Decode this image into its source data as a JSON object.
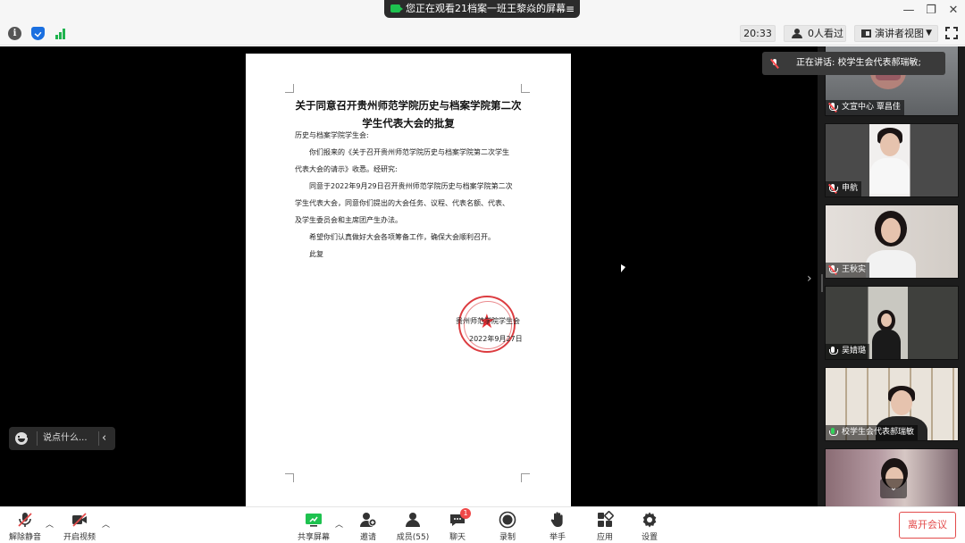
{
  "titlebar": {
    "share_notice": "您正在观看21档案一班王黎焱的屏幕",
    "menu_icon": "≡"
  },
  "statusbar": {
    "time": "20:33",
    "viewers": "0人看过",
    "view_mode": "演讲者视图"
  },
  "document": {
    "title": "关于同意召开贵州师范学院历史与档案学院第二次学生代表大会的批复",
    "addressee": "历史与档案学院学生会:",
    "p1a": "你们报来的《关于召开贵州师范学院历史与档案学院第二次学生",
    "p1b": "代表大会的请示》收悉。经研究:",
    "p2a": "同意于2022年9月29日召开贵州师范学院历史与档案学院第二次",
    "p2b": "学生代表大会，同意你们提出的大会任务、议程、代表名额、代表、",
    "p2c": "及学生委员会和主席团产生办法。",
    "p3": "希望你们认真做好大会各项筹备工作，确保大会顺利召开。",
    "closing": "此复",
    "signature": "贵州师范学院学生会",
    "date": "2022年9月27日"
  },
  "chat": {
    "placeholder": "说点什么..."
  },
  "speaking": {
    "text": "正在讲话: 校学生会代表郝瑞敏;"
  },
  "participants": [
    {
      "name": "文宣中心 覃昌佳",
      "mic": "muted"
    },
    {
      "name": "申航",
      "mic": "muted"
    },
    {
      "name": "王秋实",
      "mic": "muted"
    },
    {
      "name": "吴婧璐",
      "mic": "on"
    },
    {
      "name": "校学生会代表郝瑞敏",
      "mic": "active"
    }
  ],
  "toolbar": {
    "unmute": "解除静音",
    "start_video": "开启视频",
    "share_screen": "共享屏幕",
    "invite": "邀请",
    "members": "成员(55)",
    "chat": "聊天",
    "chat_badge": "1",
    "record": "录制",
    "raise_hand": "举手",
    "apps": "应用",
    "settings": "设置",
    "leave": "离开会议"
  },
  "colors": {
    "accent_green": "#1ec24f",
    "leave_red": "#e34b4b",
    "seal_red": "#d9272c"
  }
}
